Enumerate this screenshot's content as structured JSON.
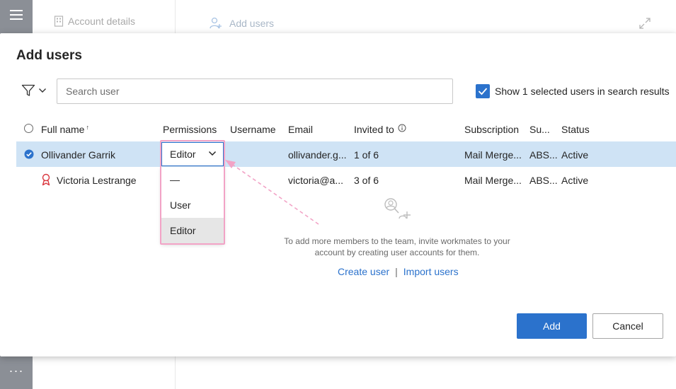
{
  "background": {
    "account_details": "Account details",
    "add_users": "Add users",
    "more": "···"
  },
  "dialog": {
    "title": "Add users",
    "search": {
      "placeholder": "Search user",
      "value": ""
    },
    "show_selected": {
      "label": "Show 1 selected users in search results",
      "checked": true
    },
    "columns": [
      "Full name",
      "Permissions",
      "Username",
      "Email",
      "Invited to",
      "Subscription",
      "Su...",
      "Status"
    ],
    "sort_indicator": "↑",
    "rows": [
      {
        "name": "Ollivander Garrik",
        "permission": "Editor",
        "username": "",
        "email": "ollivander.g...",
        "invited_to": "1 of 6",
        "subscription": "Mail Merge...",
        "su": "ABS...",
        "status": "Active",
        "selected": true
      },
      {
        "name": "Victoria Lestrange",
        "permission": "",
        "username": "",
        "email": "victoria@a...",
        "invited_to": "3 of 6",
        "subscription": "Mail Merge...",
        "su": "ABS...",
        "status": "Active",
        "selected": false
      }
    ],
    "permission_options": [
      "—",
      "User",
      "Editor"
    ],
    "permission_selected": "Editor",
    "empty_state": {
      "line1": "To add more members to the team, invite workmates to your",
      "line2": "account by creating user accounts for them."
    },
    "links": {
      "create": "Create user",
      "separator": "|",
      "import": "Import users"
    },
    "buttons": {
      "add": "Add",
      "cancel": "Cancel"
    }
  },
  "colors": {
    "accent": "#2b72cc",
    "selected_row": "#cfe3f5",
    "annotation": "#f2a3c6",
    "rail": "#8b8f96"
  }
}
